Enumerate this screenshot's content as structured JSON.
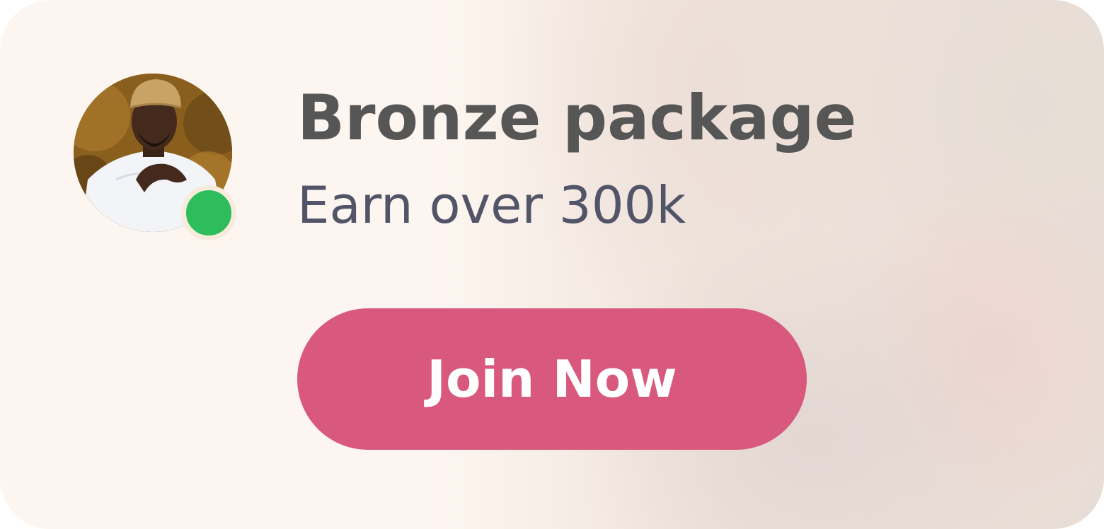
{
  "card": {
    "title": "Bronze package",
    "subtitle": "Earn over 300k",
    "cta_label": "Join Now",
    "status": "online",
    "colors": {
      "cta": "#d9597e",
      "status": "#2dbd5c",
      "title": "#565656",
      "subtitle": "#525468",
      "card_bg": "#fdf5ef"
    }
  }
}
